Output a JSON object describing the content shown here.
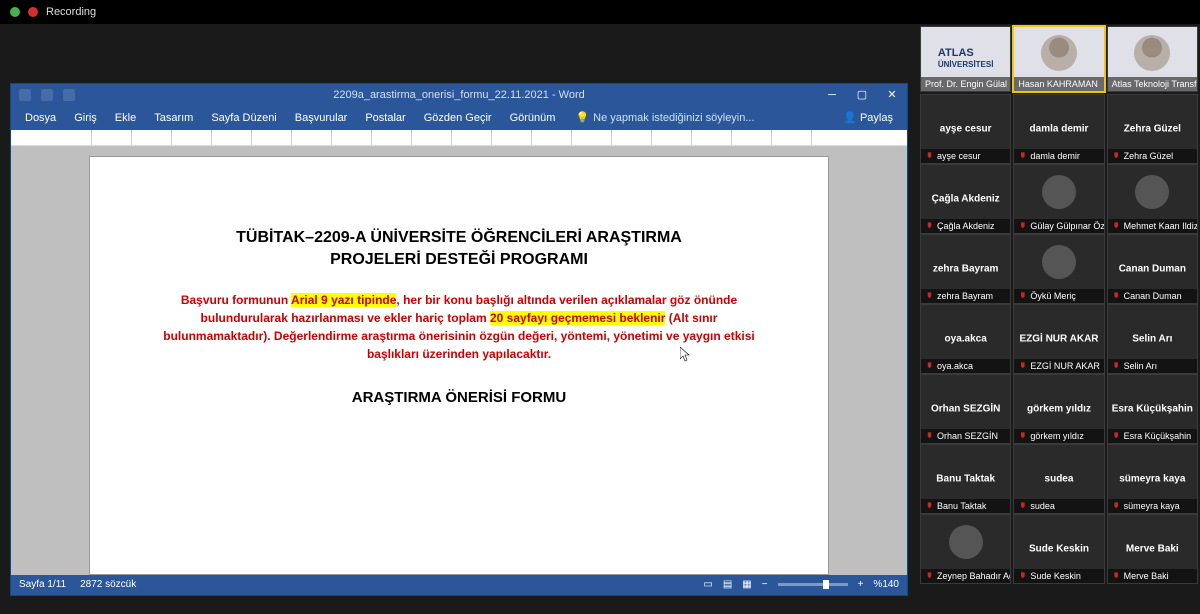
{
  "topbar": {
    "recording_label": "Recording"
  },
  "word": {
    "title": "2209a_arastirma_onerisi_formu_22.11.2021 - Word",
    "tabs": [
      "Dosya",
      "Giriş",
      "Ekle",
      "Tasarım",
      "Sayfa Düzeni",
      "Başvurular",
      "Postalar",
      "Gözden Geçir",
      "Görünüm"
    ],
    "tell_me_placeholder": "Ne yapmak istediğinizi söyleyin...",
    "share_label": "Paylaş",
    "status": {
      "page": "Sayfa 1/11",
      "words": "2872 sözcük",
      "lang": "",
      "zoom": "%140"
    },
    "doc": {
      "title_line1": "TÜBİTAK–2209-A ÜNİVERSİTE ÖĞRENCİLERİ ARAŞTIRMA",
      "title_line2": "PROJELERİ DESTEĞİ PROGRAMI",
      "para_pre": "Başvuru formunun ",
      "para_hl1": "Arial 9 yazı tipinde",
      "para_mid1": ", her bir konu başlığı altında verilen açıklamalar göz önünde bulundurularak hazırlanması ve ekler hariç toplam ",
      "para_hl2": "20 sayfayı geçmemesi beklenir",
      "para_post": " (Alt sınır bulunmamaktadır). Değerlendirme araştırma önerisinin özgün değeri, yöntemi, yönetimi ve yaygın etkisi başlıkları üzerinden yapılacaktır.",
      "subtitle": "ARAŞTIRMA ÖNERİSİ FORMU"
    }
  },
  "logo": {
    "line1": "ATLAS",
    "line2": "ÜNİVERSİTESİ"
  },
  "participants": {
    "row0": [
      {
        "name": "Prof. Dr. Engin Gülal -",
        "video": true
      },
      {
        "name": "Hasan KAHRAMAN",
        "video": true,
        "speaking": true
      },
      {
        "name": "Atlas Teknoloji Transfer ...",
        "video": true
      }
    ],
    "rows": [
      [
        {
          "name": "ayşe cesur",
          "muted": true
        },
        {
          "name": "damla demir",
          "muted": true
        },
        {
          "name": "Zehra Güzel",
          "muted": true
        }
      ],
      [
        {
          "name": "Çağla Akdeniz",
          "muted": true
        },
        {
          "name": "Gülay Gülpınar Özoran",
          "muted": true,
          "avatar": true
        },
        {
          "name": "Mehmet Kaan Ildiz",
          "muted": true,
          "avatar": true
        }
      ],
      [
        {
          "name": "zehra Bayram",
          "muted": true
        },
        {
          "name": "Öykü Meriç",
          "muted": true,
          "avatar": true
        },
        {
          "name": "Canan Duman",
          "muted": true
        }
      ],
      [
        {
          "name": "oya.akca",
          "muted": true
        },
        {
          "name": "EZGİ NUR AKAR",
          "muted": true
        },
        {
          "name": "Selin Arı",
          "muted": true
        }
      ],
      [
        {
          "name": "Orhan SEZGİN",
          "muted": true
        },
        {
          "name": "görkem yıldız",
          "muted": true
        },
        {
          "name": "Esra Küçükşahin",
          "muted": true
        }
      ],
      [
        {
          "name": "Banu Taktak",
          "muted": true
        },
        {
          "name": "sudea",
          "muted": true
        },
        {
          "name": "sümeyra kaya",
          "muted": true
        }
      ],
      [
        {
          "name": "Zeynep Bahadır Ağce",
          "muted": true,
          "avatar": true
        },
        {
          "name": "Sude Keskin",
          "muted": true
        },
        {
          "name": "Merve Baki",
          "muted": true
        }
      ]
    ]
  }
}
